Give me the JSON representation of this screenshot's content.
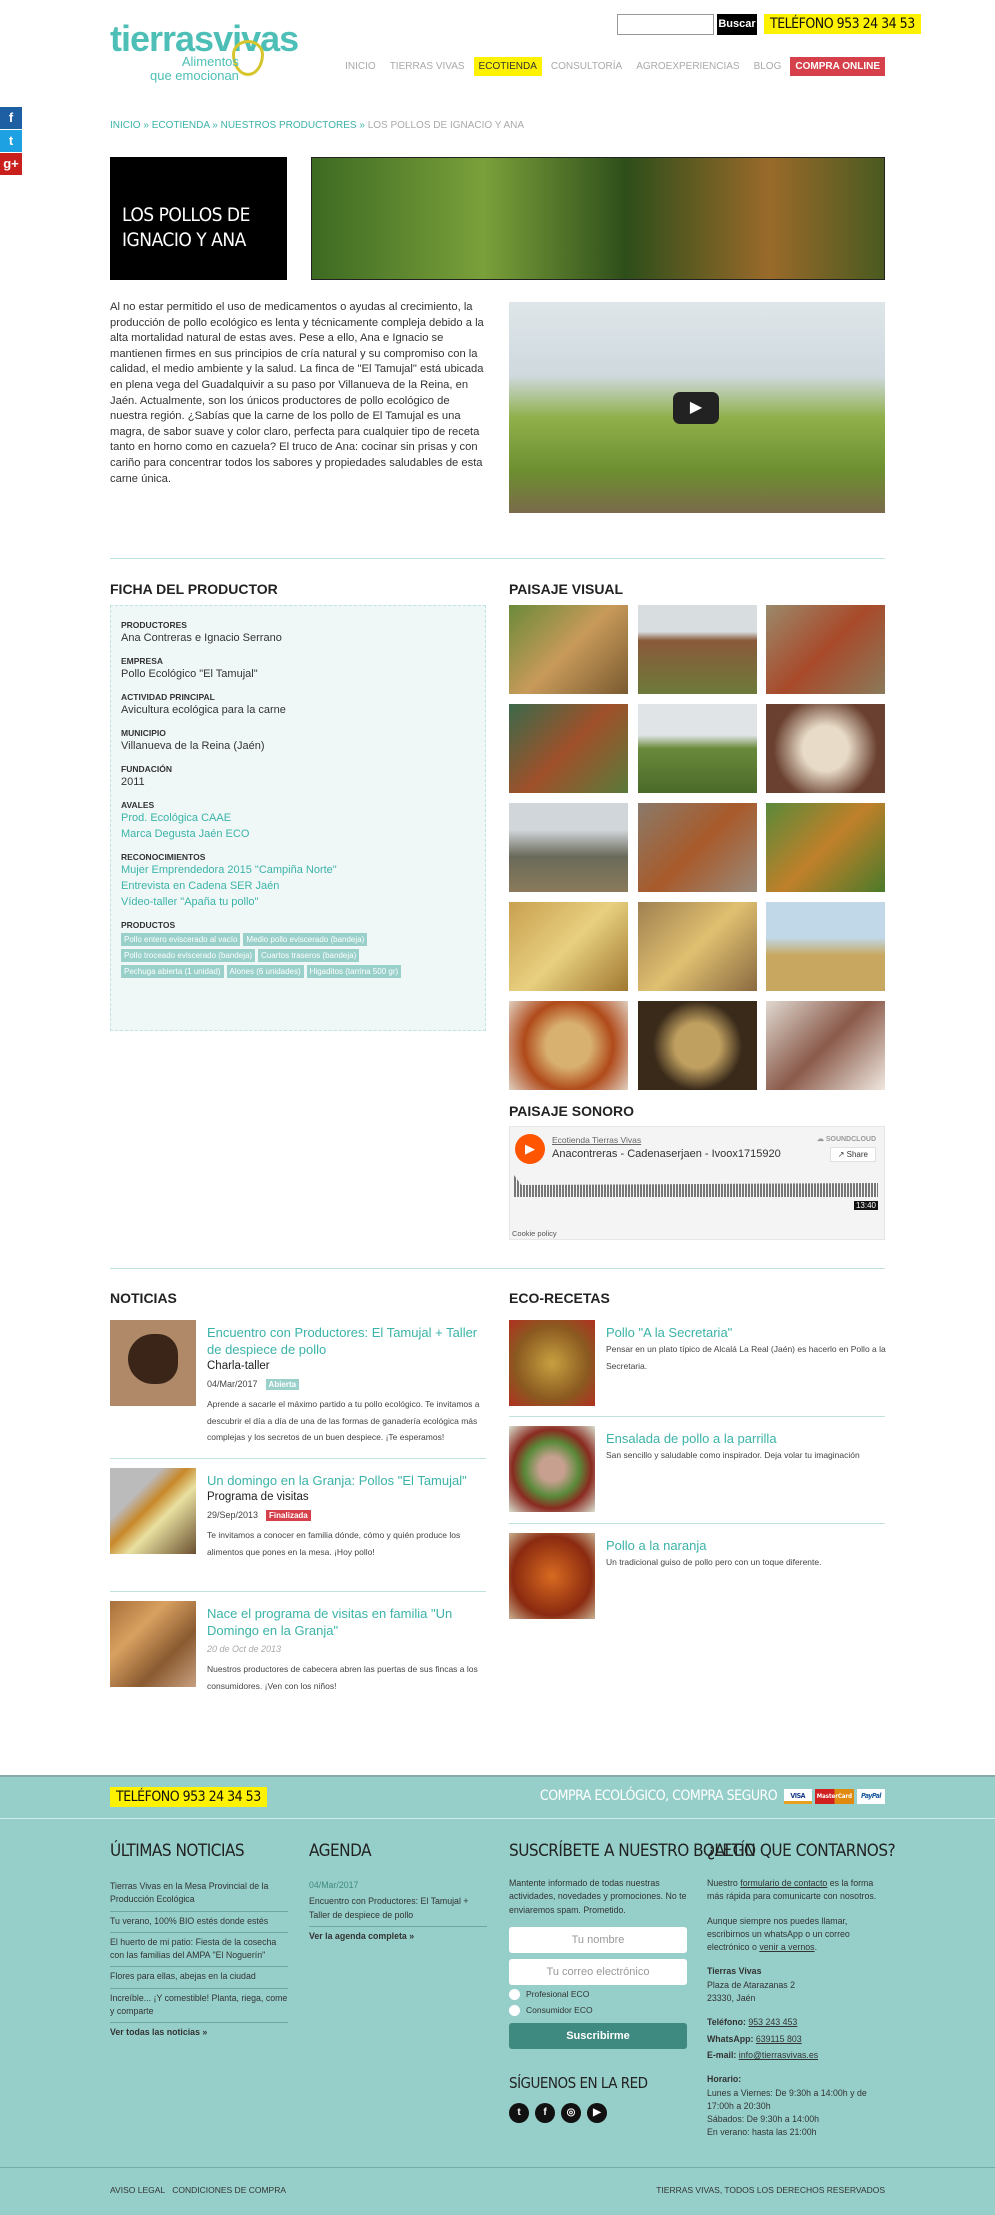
{
  "header": {
    "logo_text": "tierrasvivas",
    "logo_tagline_1": "Alimentos",
    "logo_tagline_2": "que emocionan",
    "search_placeholder": "",
    "search_button": "Buscar",
    "phone": "TELÉFONO 953 24 34 53",
    "nav": [
      "INICIO",
      "TIERRAS VIVAS",
      "ECOTIENDA",
      "CONSULTORÍA",
      "AGROEXPERIENCIAS",
      "BLOG",
      "COMPRA ONLINE"
    ]
  },
  "social": {
    "facebook": "f",
    "twitter": "t",
    "googleplus": "g+"
  },
  "breadcrumb": {
    "items": [
      "INICIO",
      "ECOTIENDA",
      "NUESTROS PRODUCTORES"
    ],
    "sep": " » ",
    "current": "LOS POLLOS DE IGNACIO Y ANA"
  },
  "page": {
    "title_line1": "LOS POLLOS DE",
    "title_line2": "IGNACIO Y ANA",
    "intro": "Al no estar permitido el uso de medicamentos o ayudas al crecimiento, la producción de pollo ecológico es lenta y técnicamente compleja debido a la alta mortalidad natural de estas aves. Pese a ello, Ana e Ignacio se mantienen firmes en sus principios de cría natural y su compromiso con la calidad, el medio ambiente y la salud. La finca de \"El Tamujal\" está ubicada en plena vega del Guadalquivir a su paso por Villanueva de la Reina, en Jaén. Actualmente, son los únicos productores de pollo ecológico de nuestra región. ¿Sabías que la carne de los pollo de El Tamujal es una magra, de sabor suave y color claro, perfecta para cualquier tipo de receta tanto en horno como en cazuela? El truco de Ana: cocinar sin prisas y con cariño para concentrar todos los sabores y propiedades saludables de esta carne única."
  },
  "ficha": {
    "heading": "FICHA DEL PRODUCTOR",
    "productores_label": "PRODUCTORES",
    "productores": "Ana Contreras e Ignacio Serrano",
    "empresa_label": "EMPRESA",
    "empresa": "Pollo Ecológico \"El Tamujal\"",
    "actividad_label": "ACTIVIDAD PRINCIPAL",
    "actividad": "Avicultura ecológica para la carne",
    "municipio_label": "MUNICIPIO",
    "municipio": "Villanueva de la Reina (Jaén)",
    "fundacion_label": "FUNDACIÓN",
    "fundacion": "2011",
    "avales_label": "AVALES",
    "avales": [
      "Prod. Ecológica CAAE",
      "Marca Degusta Jaén ECO"
    ],
    "reconocimientos_label": "RECONOCIMIENTOS",
    "reconocimientos": [
      "Mujer Emprendedora 2015 \"Campiña Norte\"",
      "Entrevista en Cadena SER Jaén",
      "Vídeo-taller \"Apaña tu pollo\""
    ],
    "productos_label": "PRODUCTOS",
    "productos": [
      "Pollo entero eviscerado al vacío",
      "Medio pollo eviscerado (bandeja)",
      "Pollo troceado eviscerado (bandeja)",
      "Cuartos traseros (bandeja)",
      "Pechuga abierta (1 unidad)",
      "Alones (6 unidades)",
      "Higaditos (tarrina 500 gr)"
    ]
  },
  "paisaje_visual": {
    "heading": "PAISAJE VISUAL"
  },
  "paisaje_sonoro": {
    "heading": "PAISAJE SONORO",
    "user": "Ecotienda Tierras Vivas",
    "track": "Anacontreras - Cadenaserjaen - Ivoox1715920",
    "brand": "SOUNDCLOUD",
    "share": "Share",
    "duration": "13:40",
    "cookie": "Cookie policy"
  },
  "noticias": {
    "heading": "NOTICIAS",
    "items": [
      {
        "title": "Encuentro con Productores: El Tamujal + Taller de despiece de pollo",
        "subtitle": "Charla-taller",
        "date": "04/Mar/2017",
        "status": "Abierta",
        "desc": "Aprende a sacarle el máximo partido a tu pollo ecológico. Te invitamos a descubrir el día a día de una de las formas de ganadería ecológica más complejas y los secretos de un buen despiece. ¡Te esperamos!"
      },
      {
        "title": "Un domingo en la Granja: Pollos \"El Tamujal\"",
        "subtitle": "Programa de visitas",
        "date": "29/Sep/2013",
        "status": "Finalizada",
        "desc": "Te invitamos a conocer en familia dónde, cómo y quién produce los alimentos que pones en la mesa. ¡Hoy pollo!"
      },
      {
        "title": "Nace el programa de visitas en familia \"Un Domingo en la Granja\"",
        "date": "20 de Oct de 2013",
        "desc": "Nuestros productores de cabecera abren las puertas de sus fincas a los consumidores. ¡Ven con los niños!"
      }
    ]
  },
  "recetas": {
    "heading": "ECO-RECETAS",
    "items": [
      {
        "title": "Pollo \"A la Secretaria\"",
        "desc": "Pensar en un plato típico de Alcalá La Real (Jaén) es hacerlo en Pollo a la Secretaria."
      },
      {
        "title": "Ensalada de pollo a la parrilla",
        "desc": "San sencillo y saludable como inspirador.  Deja volar tu imaginación"
      },
      {
        "title": "Pollo a la naranja",
        "desc": "Un tradicional guiso de pollo pero con un toque diferente."
      }
    ]
  },
  "footer": {
    "phone": "TELÉFONO 953 24 34 53",
    "secure": "COMPRA ECOLÓGICO, COMPRA SEGURO",
    "cards": [
      "VISA",
      "MasterCard",
      "PayPal"
    ],
    "ultimas": {
      "heading": "ÚLTIMAS NOTICIAS",
      "items": [
        "Tierras Vivas en la Mesa Provincial de la Producción Ecológica",
        "Tu verano, 100% BIO estés donde estés",
        "El huerto de mi patio: Fiesta de la cosecha con las familias del AMPA \"El Noguerín\"",
        "Flores para ellas, abejas en la ciudad",
        "Increíble... ¡Y comestible! Planta, riega, come y comparte"
      ],
      "more": "Ver todas las noticias »"
    },
    "agenda": {
      "heading": "AGENDA",
      "date": "04/Mar/2017",
      "item": "Encuentro con Productores: El Tamujal + Taller de despiece de pollo",
      "more": "Ver la agenda completa »"
    },
    "boletin": {
      "heading": "SUSCRÍBETE A NUESTRO BOLETÍN",
      "text": "Mantente informado de todas nuestras actividades, novedades y promociones. No te enviaremos spam. Prometido.",
      "name_placeholder": "Tu nombre",
      "email_placeholder": "Tu correo electrónico",
      "options": [
        "Profesional ECO",
        "Consumidor ECO"
      ],
      "button": "Suscribirme",
      "social_heading": "SÍGUENOS EN LA RED"
    },
    "contacto": {
      "heading": "¿ALGO QUE CONTARNOS?",
      "p1_a": "Nuestro ",
      "p1_link": "formulario de contacto",
      "p1_b": " es la forma más rápida para comunicarte con nosotros.",
      "p2_a": "Aunque siempre nos puedes llamar, escribirnos un whatsApp o un correo electrónico o ",
      "p2_link": "venir a vernos",
      "p2_b": ".",
      "name": "Tierras Vivas",
      "addr1": "Plaza de Atarazanas 2",
      "addr2": "23330, Jaén",
      "tel_label": "Teléfono:",
      "tel": "953 243 453",
      "wa_label": "WhatsApp:",
      "wa": "639115 803",
      "mail_label": "E-mail:",
      "mail": "info@tierrasvivas.es",
      "horario_label": "Horario:",
      "h1": "Lunes a Viernes: De 9:30h a 14:00h y de 17:00h a 20:30h",
      "h2": "Sábados: De 9:30h a 14:00h",
      "h3": "En verano: hasta las 21:00h"
    },
    "legal": [
      "AVISO LEGAL",
      "CONDICIONES DE COMPRA"
    ],
    "copyright": "TIERRAS VIVAS, TODOS LOS DERECHOS RESERVADOS"
  }
}
